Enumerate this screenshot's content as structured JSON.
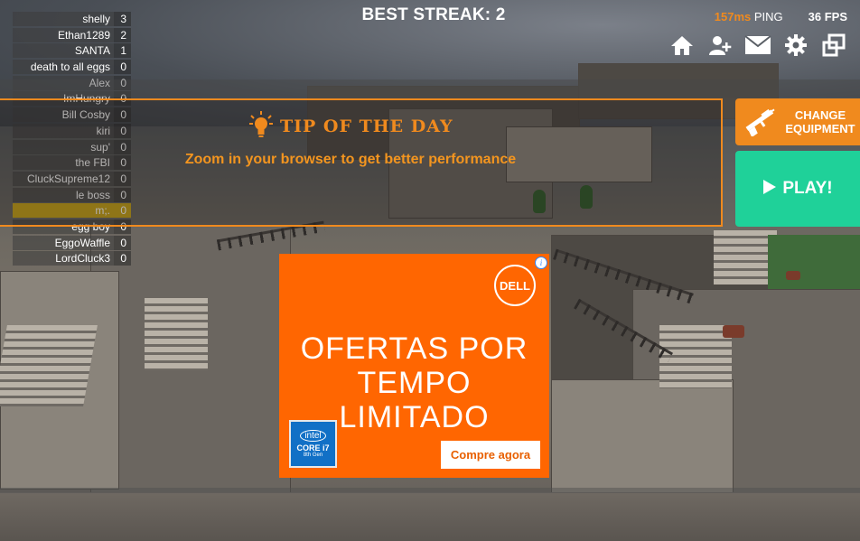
{
  "hud": {
    "best_streak": "BEST STREAK: 2",
    "ping_value": "157ms",
    "ping_label": " PING",
    "fps": "36 FPS"
  },
  "toolbar": {
    "icons": [
      "home-icon",
      "add-user-icon",
      "mail-icon",
      "gear-icon",
      "fullscreen-icon"
    ]
  },
  "leaderboard": [
    {
      "name": "shelly",
      "score": "3"
    },
    {
      "name": "Ethan1289",
      "score": "2"
    },
    {
      "name": "SANTA",
      "score": "1"
    },
    {
      "name": "death to all eggs",
      "score": "0"
    },
    {
      "name": "Alex",
      "score": "0"
    },
    {
      "name": "ImHungry",
      "score": "0"
    },
    {
      "name": "Bill Cosby",
      "score": "0"
    },
    {
      "name": "kiri",
      "score": "0"
    },
    {
      "name": "sup'",
      "score": "0"
    },
    {
      "name": "the FBI",
      "score": "0"
    },
    {
      "name": "CluckSupreme12",
      "score": "0"
    },
    {
      "name": "le boss",
      "score": "0"
    },
    {
      "name": "m;.",
      "score": "0"
    },
    {
      "name": "egg boy",
      "score": "0"
    },
    {
      "name": "EggoWaffle",
      "score": "0"
    },
    {
      "name": "LordCluck3",
      "score": "0"
    }
  ],
  "tip": {
    "title": "TIP OF THE DAY",
    "body": "Zoom in your browser to get better performance"
  },
  "buttons": {
    "equipment": "CHANGE\nEQUIPMENT",
    "play": "PLAY!"
  },
  "ad": {
    "brand": "DELL",
    "headline_1": "OFERTAS POR",
    "headline_2": "TEMPO LIMITADO",
    "chip_1": "intel",
    "chip_2": "CORE i7",
    "chip_3": "8th Gen",
    "cta": "Compre agora",
    "colors": {
      "background": "#ff6601",
      "cta_text": "#e85f00"
    }
  },
  "colors": {
    "accent_orange": "#f08a1e",
    "play_green": "#1fd199",
    "highlight_row": "#c9a516"
  }
}
